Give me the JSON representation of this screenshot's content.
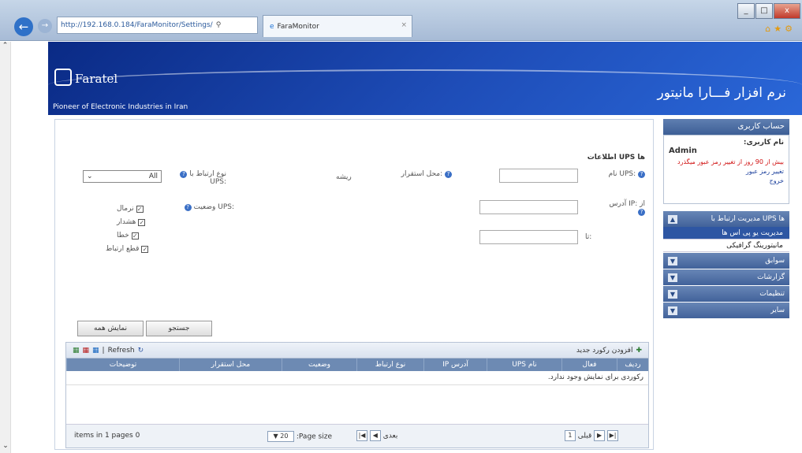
{
  "browser": {
    "url": "http://192.168.0.184/FaraMonitor/Settings/",
    "tab_title": "FaraMonitor",
    "tab_close": "×",
    "window_buttons": [
      "_",
      "□",
      "x"
    ]
  },
  "banner": {
    "logo_text": "Faratel",
    "tagline": "Pioneer of Electronic Industries in Iran",
    "app_title": "نرم افزار فـــارا مانیتور"
  },
  "form": {
    "section_title": "اطلاعات UPS ها",
    "ups_name_label": "نام UPS:",
    "location_label": "محل استقرار:",
    "root_label": "ریشه",
    "connection_label": "نوع ارتباط با UPS:",
    "connection_value": "All",
    "ip_label": "آدرس IP: از",
    "to_label": "تا:",
    "status_label": "وضعیت UPS:",
    "status_options": [
      "نرمال",
      "هشدار",
      "خطا",
      "قطع ارتباط"
    ],
    "search_button": "جستجو",
    "show_all_button": "نمایش همه"
  },
  "grid": {
    "add_record": "افزودن رکورد جدید",
    "refresh": "Refresh",
    "columns": [
      "ردیف",
      "فعال",
      "نام UPS",
      "آدرس IP",
      "نوع ارتباط",
      "وضعیت",
      "محل استقرار",
      "توضیحات"
    ],
    "empty_message": "رکوردی برای نمایش وجود ندارد.",
    "pager_next": "بعدی",
    "pager_prev": "قبلی",
    "pager_page": "1",
    "page_size_label": ":Page size",
    "page_size_value": "20",
    "items_info": "items in 1 pages 0"
  },
  "sidebar": {
    "account_header": "حساب کاربری",
    "username_label": "نام کاربری:",
    "username": "Admin",
    "password_warning": "بیش از 90 روز از تغییر رمز عبور میگذرد",
    "change_password": "تغییر رمز عبور",
    "logout": "خروج",
    "sections": [
      {
        "label": "مدیریت ارتباط با UPS ها",
        "expanded": true
      },
      {
        "label": "سوابق",
        "expanded": false
      },
      {
        "label": "گزارشات",
        "expanded": false
      },
      {
        "label": "تنظیمات",
        "expanded": false
      },
      {
        "label": "سایر",
        "expanded": false
      }
    ],
    "submenu": [
      "مدیریت یو پی اس ها",
      "مانیتورینگ گرافیکی"
    ]
  }
}
